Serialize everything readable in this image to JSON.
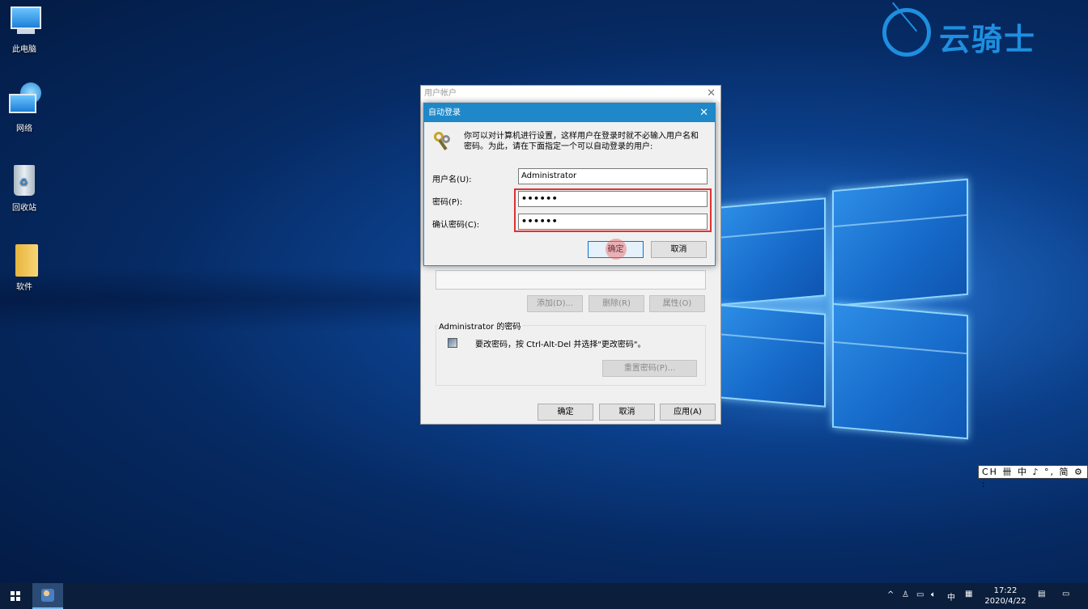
{
  "desktop": {
    "icons": [
      {
        "label": "此电脑"
      },
      {
        "label": "网络"
      },
      {
        "label": "回收站"
      },
      {
        "label": "软件"
      }
    ]
  },
  "watermark": {
    "text": "云骑士"
  },
  "user_accounts": {
    "title": "用户帐户",
    "add_btn": "添加(D)...",
    "remove_btn": "删除(R)",
    "props_btn": "属性(O)",
    "password_group": "Administrator 的密码",
    "password_hint": "要改密码，按 Ctrl-Alt-Del 并选择\"更改密码\"。",
    "reset_btn": "重置密码(P)...",
    "ok": "确定",
    "cancel": "取消",
    "apply": "应用(A)"
  },
  "auto_login": {
    "title": "自动登录",
    "description": "你可以对计算机进行设置，这样用户在登录时就不必输入用户名和密码。为此，请在下面指定一个可以自动登录的用户:",
    "username_label": "用户名(U):",
    "username_value": "Administrator",
    "password_label": "密码(P):",
    "password_value": "••••••",
    "confirm_label": "确认密码(C):",
    "confirm_value": "••••••",
    "ok": "确定",
    "cancel": "取消"
  },
  "ime_bar": {
    "text": "CH 卌 中 ♪ °, 简 ⚙ :"
  },
  "taskbar": {
    "tray_lang": "中",
    "time": "17:22",
    "date": "2020/4/22"
  },
  "colors": {
    "accent": "#1e88c8",
    "highlight": "#e03131"
  }
}
